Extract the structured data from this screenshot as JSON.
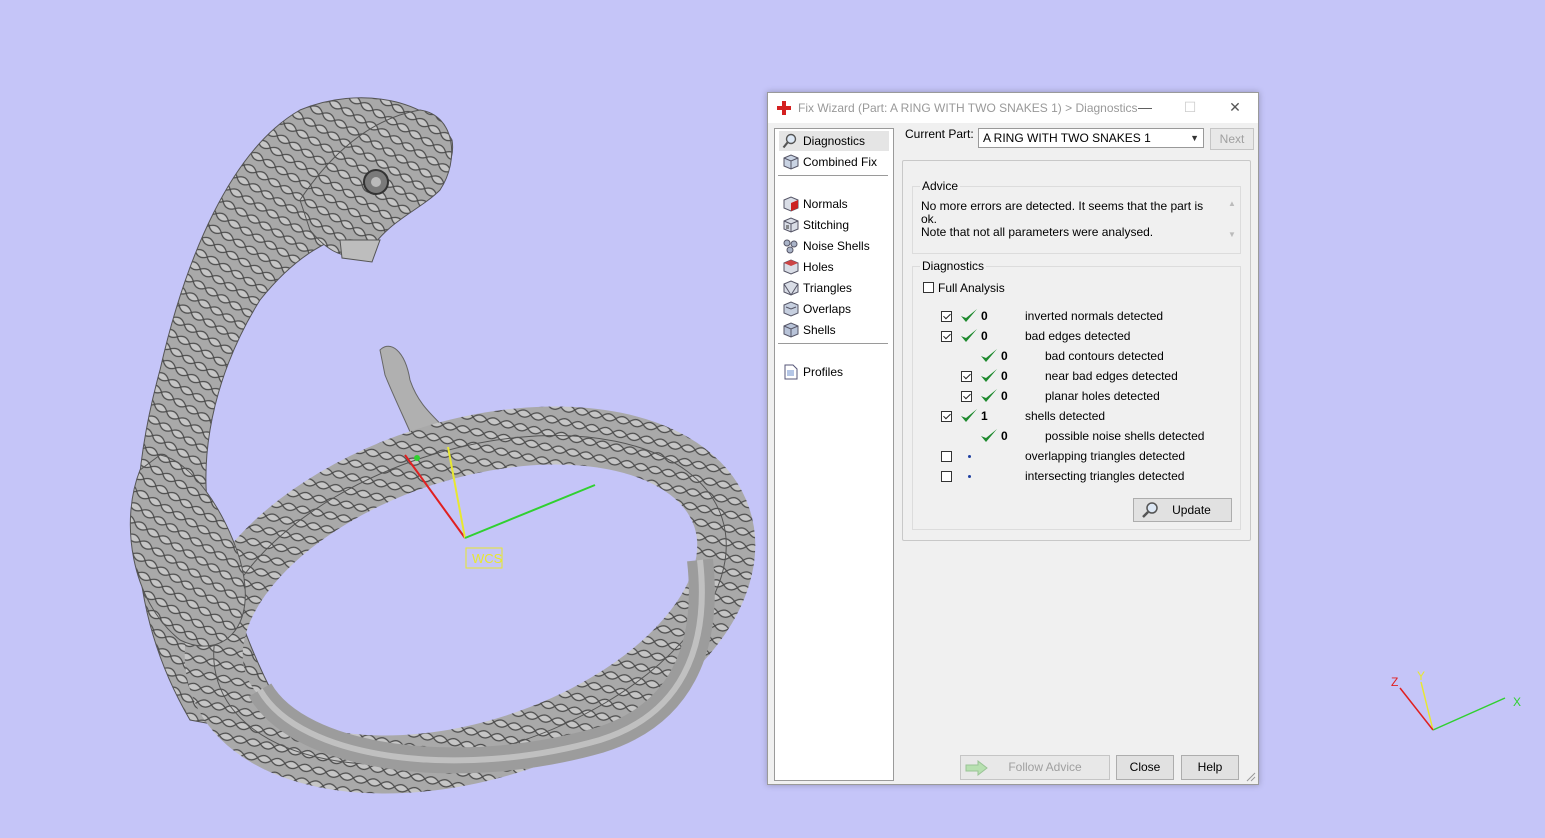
{
  "viewport": {
    "wcs_label": "WCS",
    "triad": {
      "x": "X",
      "y": "Y",
      "z": "Z"
    }
  },
  "window": {
    "title": "Fix Wizard (Part: A RING WITH TWO SNAKES 1) > Diagnostics",
    "controls": {
      "minimize": "—",
      "maximize": "☐",
      "close": "✕"
    }
  },
  "nav": {
    "top": [
      {
        "label": "Diagnostics",
        "icon": "magnifier-icon",
        "selected": true
      },
      {
        "label": "Combined Fix",
        "icon": "cube-icon"
      }
    ],
    "tools": [
      {
        "label": "Normals",
        "icon": "normals-cube-icon"
      },
      {
        "label": "Stitching",
        "icon": "stitching-cube-icon"
      },
      {
        "label": "Noise Shells",
        "icon": "noise-shells-icon"
      },
      {
        "label": "Holes",
        "icon": "holes-cube-icon"
      },
      {
        "label": "Triangles",
        "icon": "triangles-cube-icon"
      },
      {
        "label": "Overlaps",
        "icon": "overlaps-cube-icon"
      },
      {
        "label": "Shells",
        "icon": "shells-cube-icon"
      }
    ],
    "bottom": [
      {
        "label": "Profiles",
        "icon": "document-icon"
      }
    ]
  },
  "part": {
    "label": "Current Part:",
    "value": "A RING WITH TWO SNAKES 1",
    "next_label": "Next"
  },
  "advice": {
    "caption": "Advice",
    "line1": "No more errors are detected. It seems that the part is ok.",
    "line2": "Note that not all parameters were analysed."
  },
  "diagnostics": {
    "caption": "Diagnostics",
    "full_analysis": "Full Analysis",
    "rows": [
      {
        "checkbox": true,
        "checked": true,
        "status": "ok",
        "count": "0",
        "text": "inverted normals detected",
        "indent": 0
      },
      {
        "checkbox": true,
        "checked": true,
        "status": "ok",
        "count": "0",
        "text": "bad edges detected",
        "indent": 0
      },
      {
        "checkbox": false,
        "checked": false,
        "status": "ok",
        "count": "0",
        "text": "bad contours detected",
        "indent": 1
      },
      {
        "checkbox": true,
        "checked": true,
        "status": "ok",
        "count": "0",
        "text": "near bad edges detected",
        "indent": 1
      },
      {
        "checkbox": true,
        "checked": true,
        "status": "ok",
        "count": "0",
        "text": "planar holes detected",
        "indent": 1
      },
      {
        "checkbox": true,
        "checked": true,
        "status": "ok",
        "count": "1",
        "text": "shells detected",
        "indent": 0
      },
      {
        "checkbox": false,
        "checked": false,
        "status": "ok",
        "count": "0",
        "text": "possible noise shells detected",
        "indent": 1
      },
      {
        "checkbox": true,
        "checked": false,
        "status": "none",
        "count": "",
        "text": "overlapping triangles detected",
        "indent": 0
      },
      {
        "checkbox": true,
        "checked": false,
        "status": "none",
        "count": "",
        "text": "intersecting triangles detected",
        "indent": 0
      }
    ],
    "update_label": "Update"
  },
  "footer": {
    "follow_advice": "Follow Advice",
    "close": "Close",
    "help": "Help"
  },
  "colors": {
    "background": "#c5c5f8",
    "ok_check": "#1e8a2e",
    "model": "#a8a8a8"
  }
}
